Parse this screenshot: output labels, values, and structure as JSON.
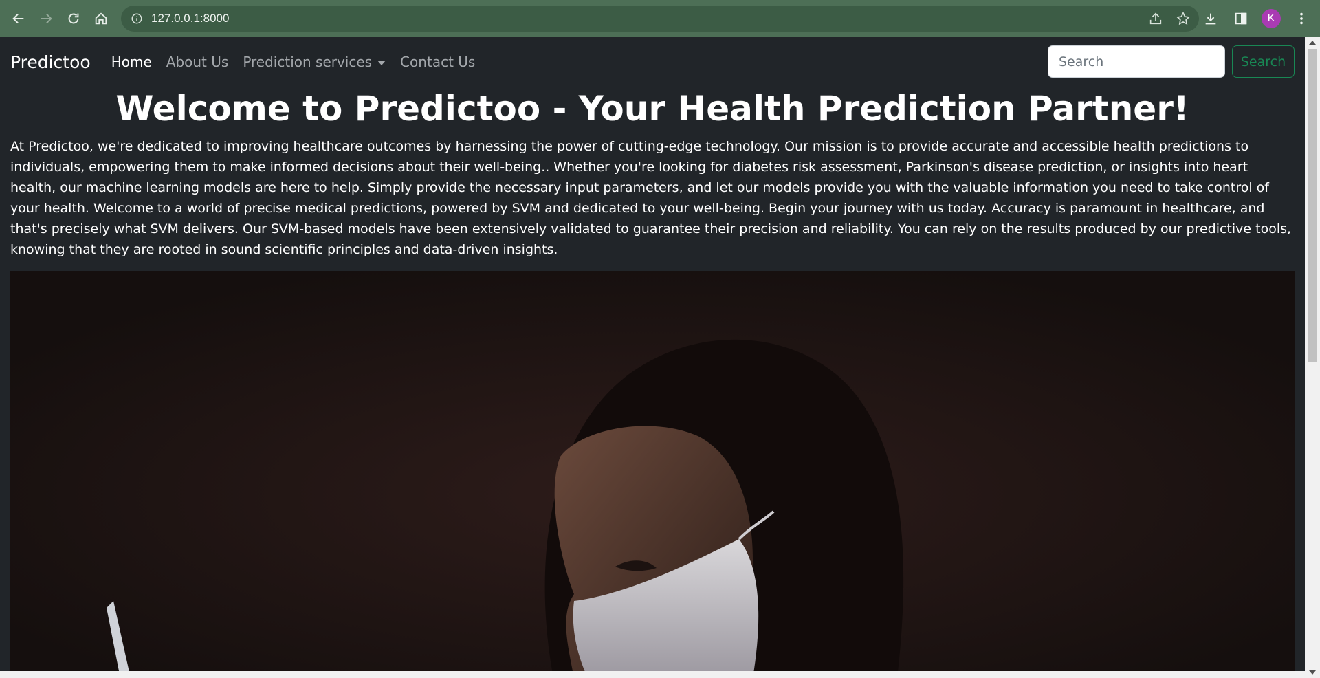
{
  "browser": {
    "url": "127.0.0.1:8000",
    "profile_initial": "K",
    "profile_color": "#a93bb3"
  },
  "navbar": {
    "brand": "Predictoo",
    "links": [
      {
        "label": "Home",
        "active": true
      },
      {
        "label": "About Us",
        "active": false
      },
      {
        "label": "Prediction services",
        "active": false,
        "dropdown": true
      },
      {
        "label": "Contact Us",
        "active": false
      }
    ],
    "search": {
      "placeholder": "Search",
      "button_label": "Search"
    }
  },
  "main": {
    "title": "Welcome to Predictoo - Your Health Prediction Partner!",
    "intro": "At Predictoo, we're dedicated to improving healthcare outcomes by harnessing the power of cutting-edge technology. Our mission is to provide accurate and accessible health predictions to individuals, empowering them to make informed decisions about their well-being.. Whether you're looking for diabetes risk assessment, Parkinson's disease prediction, or insights into heart health, our machine learning models are here to help. Simply provide the necessary input parameters, and let our models provide you with the valuable information you need to take control of your health. Welcome to a world of precise medical predictions, powered by SVM and dedicated to your well-being. Begin your journey with us today. Accuracy is paramount in healthcare, and that's precisely what SVM delivers. Our SVM-based models have been extensively validated to guarantee their precision and reliability. You can rely on the results produced by our predictive tools, knowing that they are rooted in sound scientific principles and data-driven insights."
  },
  "colors": {
    "page_bg": "#212529",
    "search_button": "#198754",
    "chrome_bg": "#4d6f56"
  }
}
